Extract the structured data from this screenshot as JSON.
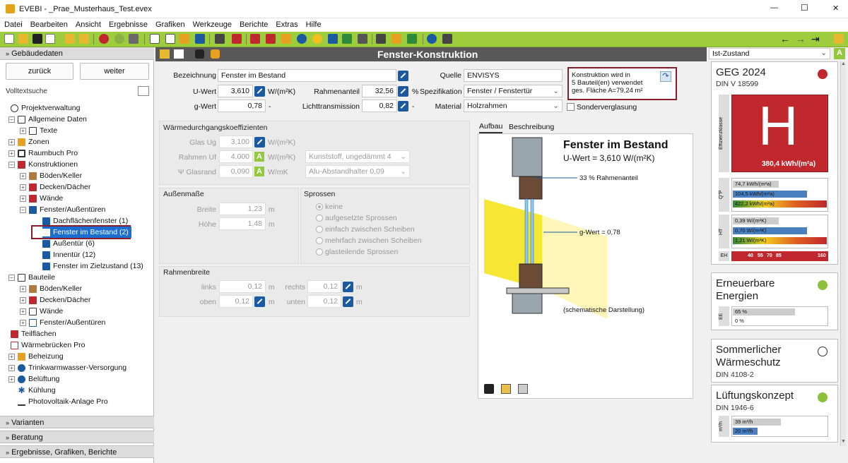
{
  "window": {
    "title": "EVEBI  - _Prae_Musterhaus_Test.evex",
    "min": "—",
    "max": "☐",
    "close": "✕"
  },
  "menu": [
    "Datei",
    "Bearbeiten",
    "Ansicht",
    "Ergebnisse",
    "Grafiken",
    "Werkzeuge",
    "Berichte",
    "Extras",
    "Hilfe"
  ],
  "left": {
    "header": "Gebäudedaten",
    "back": "zurück",
    "forward": "weiter",
    "search": "Volltextsuche",
    "tree": [
      "Projektverwaltung",
      "Allgemeine Daten",
      "Texte",
      "Zonen",
      "Raumbuch Pro",
      "Konstruktionen",
      "Böden/Keller",
      "Decken/Dächer",
      "Wände",
      "Fenster/Außentüren",
      "Dachflächenfenster (1)",
      "Fenster im Bestand (2)",
      "Außentür (6)",
      "Innentür (12)",
      "Fenster im Zielzustand (13)",
      "Bauteile",
      "Böden/Keller",
      "Decken/Dächer",
      "Wände",
      "Fenster/Außentüren",
      "Teilflächen",
      "Wärmebrücken Pro",
      "Beheizung",
      "Trinkwarmwasser-Versorgung",
      "Belüftung",
      "Kühlung",
      "Photovoltaik-Anlage Pro"
    ],
    "footer": [
      "Varianten",
      "Beratung",
      "Ergebnisse, Grafiken, Berichte"
    ]
  },
  "center": {
    "title": "Fenster-Konstruktion",
    "labels": {
      "bezeichnung": "Bezeichnung",
      "uwert": "U-Wert",
      "gwert": "g-Wert",
      "rahmenanteil": "Rahmenanteil",
      "licht": "Lichttransmission",
      "quelle": "Quelle",
      "spez": "Spezifikation",
      "material": "Material",
      "sonder": "Sonderverglasung"
    },
    "values": {
      "bezeichnung": "Fenster im Bestand",
      "uwert": "3,610",
      "uunit": "W/(m²K)",
      "gwert": "0,78",
      "gunit": "-",
      "rahmenanteil": "32,56",
      "runit": "%",
      "licht": "0,82",
      "lunit": "-",
      "quelle": "ENVISYS",
      "spez": "Fenster / Fenstertür",
      "material": "Holzrahmen"
    },
    "info": [
      "Konstruktion wird in",
      "5 Bauteil(en) verwendet",
      "ges. Fläche A=79,24 m²"
    ],
    "wk": {
      "title": "Wärmedurchgangskoeffizienten",
      "rows": [
        {
          "label": "Glas Ug",
          "value": "3,100",
          "unit": "W/(m²K)",
          "sel": ""
        },
        {
          "label": "Rahmen Uf",
          "value": "4,000",
          "unit": "W/(m²K)",
          "sel": "Kunststoff, ungedämmt 4"
        },
        {
          "label": "Glasrand",
          "value": "0,090",
          "unit": "W/mK",
          "sel": "Alu-Abstandhalter 0,09"
        }
      ]
    },
    "masse": {
      "title": "Außenmaße",
      "breite_l": "Breite",
      "breite": "1,23",
      "hoehe_l": "Höhe",
      "hoehe": "1,48",
      "unit": "m"
    },
    "sprossen": {
      "title": "Sprossen",
      "opts": [
        "keine",
        "aufgesetzte Sprossen",
        "einfach zwischen Scheiben",
        "mehrfach zwischen Scheiben",
        "glasteilende Sprossen"
      ]
    },
    "rahmen": {
      "title": "Rahmenbreite",
      "links_l": "links",
      "links": "0,12",
      "rechts_l": "rechts",
      "rechts": "0,12",
      "oben_l": "oben",
      "oben": "0,12",
      "unten_l": "unten",
      "unten": "0,12",
      "unit": "m"
    },
    "tabs": [
      "Aufbau",
      "Beschreibung"
    ],
    "drawing": {
      "title": "Fenster im Bestand",
      "uwert": "U-Wert = 3,610 W/(m²K)",
      "rahmen": "33 % Rahmenanteil",
      "gwert": "g-Wert = 0,78",
      "note": "(schematische Darstellung)"
    }
  },
  "right": {
    "state": "Ist-Zustand",
    "geg": {
      "title": "GEG 2024",
      "sub": "DIN V 18599",
      "cls": "H",
      "side": "Effizienzklasse",
      "value": "380,4 kWh/(m²a)",
      "q": [
        "74,7 kWh/(m²a)",
        "104,5 kWh/(m²a)",
        "422,2 kWh/(m²a)"
      ],
      "ht": [
        "0,39 W/(m²K)",
        "0,70 W/(m²K)",
        "1,21 W/(m²K)"
      ],
      "q_l": "Q\"P",
      "ht_l": "HT",
      "eh_l": "EH",
      "eh": [
        "40",
        "55",
        "70",
        "85",
        "160"
      ]
    },
    "ee": {
      "title1": "Erneuerbare",
      "title2": "Energien",
      "l": "EE",
      "v": [
        "65 %",
        "0 %"
      ]
    },
    "sw": {
      "title1": "Sommerlicher",
      "title2": "Wärmeschutz",
      "sub": "DIN 4108-2"
    },
    "lk": {
      "title": "Lüftungskonzept",
      "sub": "DIN 1946-6",
      "l": "m³/h",
      "v": [
        "39 m³/h",
        "20 m³/h"
      ]
    },
    "colors": {
      "red": "#c0282d",
      "green": "#8cbf3a"
    }
  }
}
